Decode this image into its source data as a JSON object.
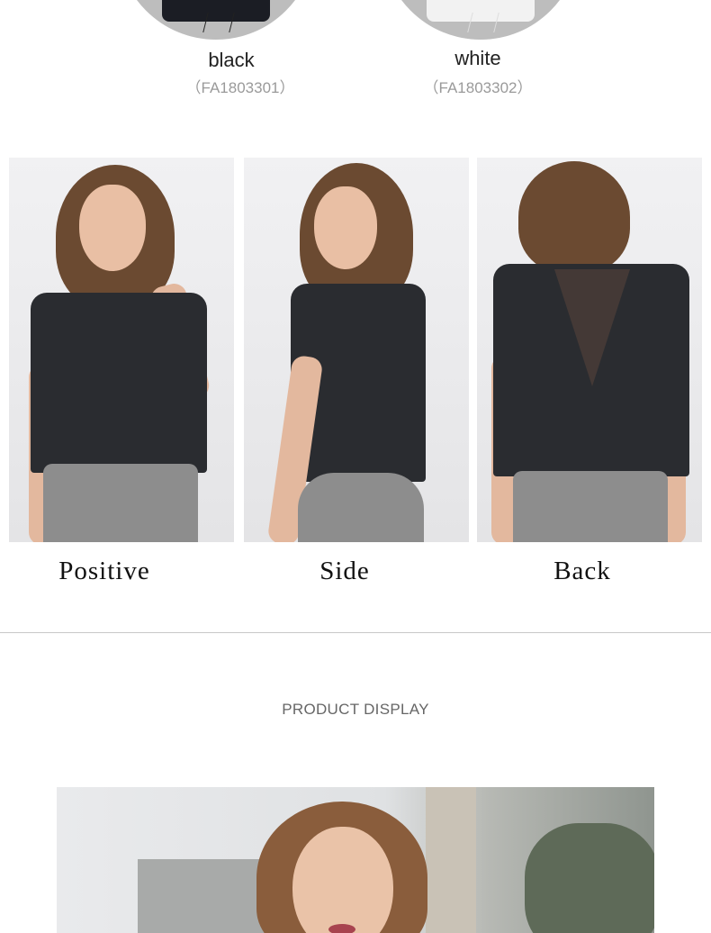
{
  "colors": [
    {
      "name": "black",
      "code": "（FA1803301）"
    },
    {
      "name": "white",
      "code": "（FA1803302）"
    }
  ],
  "views": [
    {
      "label": "Positive"
    },
    {
      "label": "Side"
    },
    {
      "label": "Back"
    }
  ],
  "section": {
    "title": "PRODUCT DISPLAY"
  },
  "palette": {
    "shirt_black": "#1b1d24",
    "shirt_white": "#f2f2f2",
    "swatch_bg": "#bdbdbd",
    "divider": "#c8c8c8",
    "title_text": "#666666"
  }
}
